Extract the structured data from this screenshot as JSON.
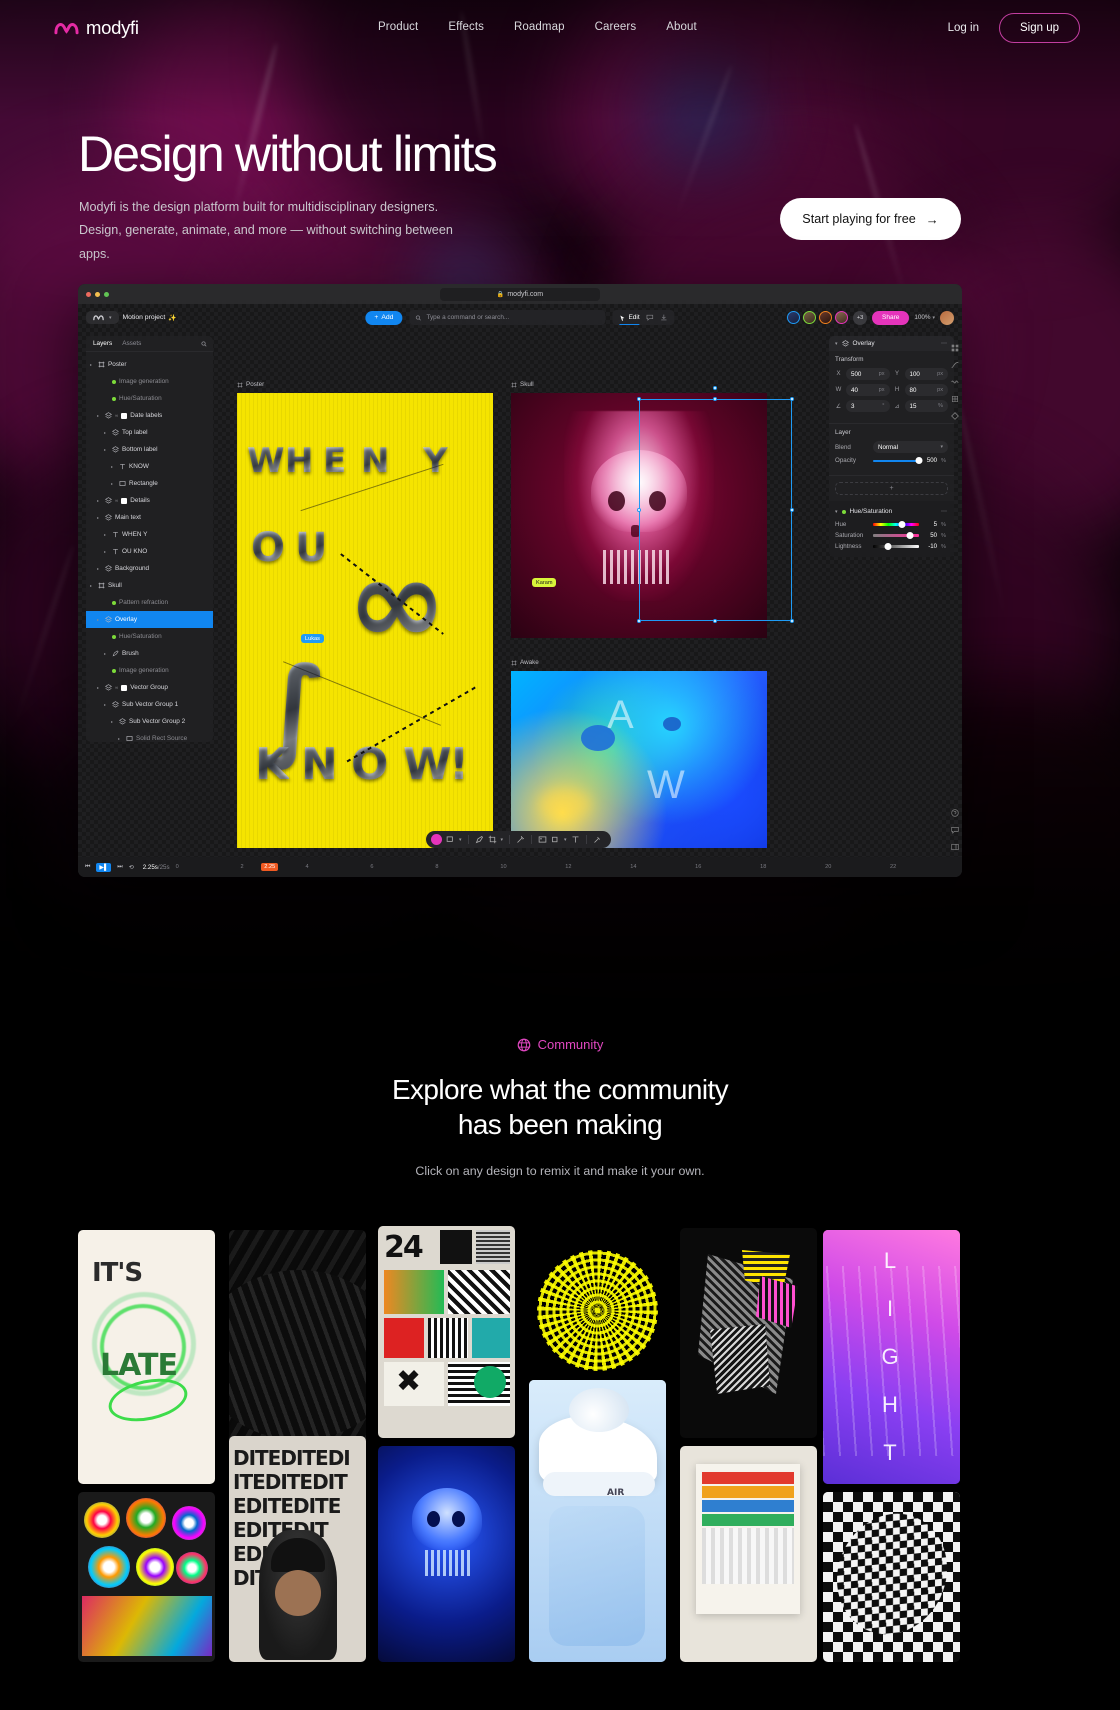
{
  "nav": {
    "logo_text": "modyfi",
    "logo_icon": "modyfi-logo-icon",
    "links": [
      {
        "label": "Product"
      },
      {
        "label": "Effects"
      },
      {
        "label": "Roadmap"
      },
      {
        "label": "Careers"
      },
      {
        "label": "About"
      }
    ],
    "login_label": "Log in",
    "signup_label": "Sign up",
    "accent": "#c23ea0"
  },
  "hero": {
    "title": "Design without limits",
    "subtitle": "Modyfi is the design platform built for multidisciplinary designers. Design, generate, animate, and more — without switching between apps.",
    "cta_label": "Start playing for free",
    "cta_arrow": "→"
  },
  "app": {
    "browser": {
      "url": "modyfi.com",
      "lock_icon": "lock-icon",
      "dots": [
        "close-dot",
        "minimize-dot",
        "maximize-dot"
      ]
    },
    "toolbar": {
      "project_name": "Motion project",
      "project_sparkle": "✨",
      "add_label": "Add",
      "search_placeholder": "Type a command or search...",
      "edit_label": "Edit",
      "comment_icon": "comment-icon",
      "export_icon": "download-icon",
      "collaborators_extra": "+3",
      "share_label": "Share",
      "zoom_level": "100%"
    },
    "layers_panel": {
      "tab_layers": "Layers",
      "tab_assets": "Assets",
      "search_icon": "search-icon",
      "items": [
        {
          "label": "Poster",
          "depth": 0,
          "type": "group",
          "dim": false,
          "selected": false
        },
        {
          "label": "Image generation",
          "depth": 2,
          "type": "effect",
          "dim": true,
          "selected": false
        },
        {
          "label": "Hue/Saturation",
          "depth": 2,
          "type": "effect",
          "dim": true,
          "selected": false
        },
        {
          "label": "Date labels",
          "depth": 1,
          "type": "maskgroup",
          "dim": false,
          "selected": false
        },
        {
          "label": "Top label",
          "depth": 2,
          "type": "layer",
          "dim": false,
          "selected": false
        },
        {
          "label": "Bottom label",
          "depth": 2,
          "type": "layer",
          "dim": false,
          "selected": false
        },
        {
          "label": "KNOW",
          "depth": 3,
          "type": "text",
          "dim": false,
          "selected": false
        },
        {
          "label": "Rectangle",
          "depth": 3,
          "type": "shape",
          "dim": false,
          "selected": false
        },
        {
          "label": "Details",
          "depth": 1,
          "type": "maskgroup",
          "dim": false,
          "selected": false
        },
        {
          "label": "Main text",
          "depth": 1,
          "type": "layer",
          "dim": false,
          "selected": false
        },
        {
          "label": "WHEN Y",
          "depth": 2,
          "type": "text",
          "dim": false,
          "selected": false
        },
        {
          "label": "OU KNO",
          "depth": 2,
          "type": "text",
          "dim": false,
          "selected": false
        },
        {
          "label": "Background",
          "depth": 1,
          "type": "layer",
          "dim": false,
          "selected": false
        },
        {
          "label": "Skull",
          "depth": 0,
          "type": "group",
          "dim": false,
          "selected": false
        },
        {
          "label": "Pattern refraction",
          "depth": 2,
          "type": "effect",
          "dim": true,
          "selected": false
        },
        {
          "label": "Overlay",
          "depth": 1,
          "type": "layer",
          "dim": false,
          "selected": true
        },
        {
          "label": "Hue/Saturation",
          "depth": 2,
          "type": "effect",
          "dim": true,
          "selected": false
        },
        {
          "label": "Brush",
          "depth": 2,
          "type": "brush",
          "dim": false,
          "selected": false
        },
        {
          "label": "Image generation",
          "depth": 2,
          "type": "effect",
          "dim": true,
          "selected": false
        },
        {
          "label": "Vector Group",
          "depth": 1,
          "type": "maskgroup",
          "dim": false,
          "selected": false
        },
        {
          "label": "Sub Vector Group 1",
          "depth": 2,
          "type": "layer",
          "dim": false,
          "selected": false
        },
        {
          "label": "Sub Vector Group 2",
          "depth": 3,
          "type": "layer",
          "dim": false,
          "selected": false
        },
        {
          "label": "Solid Rect Source",
          "depth": 4,
          "type": "shape",
          "dim": true,
          "selected": false
        }
      ]
    },
    "canvas": {
      "frames": [
        {
          "label": "Poster"
        },
        {
          "label": "Skull"
        },
        {
          "label": "Awake"
        }
      ],
      "poster_words": [
        "WHEN",
        "Y",
        "OU",
        "KNO",
        "W"
      ],
      "awake_letters": [
        "A",
        "W"
      ],
      "cursors": [
        {
          "name": "Karam",
          "color": "#d9f53a"
        },
        {
          "name": "Lukas",
          "color": "#1f9bf5"
        }
      ]
    },
    "properties": {
      "header": "Overlay",
      "menu_icon": "more-icon",
      "transform_title": "Transform",
      "fields": [
        {
          "key": "X",
          "value": "500",
          "unit": "px"
        },
        {
          "key": "Y",
          "value": "100",
          "unit": "px"
        },
        {
          "key": "W",
          "value": "40",
          "unit": "px"
        },
        {
          "key": "H",
          "value": "80",
          "unit": "px"
        },
        {
          "key": "∠",
          "value": "3",
          "unit": "°"
        },
        {
          "key": "⊿",
          "value": "15",
          "unit": "%"
        }
      ],
      "layer_title": "Layer",
      "blend_label": "Blend",
      "blend_value": "Normal",
      "opacity_label": "Opacity",
      "opacity_value": "500",
      "opacity_unit": "%",
      "add_effect_label": "+",
      "effect_header": "Hue/Saturation",
      "effect_rows": [
        {
          "label": "Hue",
          "value": "5",
          "unit": "%",
          "pos": 62
        },
        {
          "label": "Saturation",
          "value": "50",
          "unit": "%",
          "pos": 80
        },
        {
          "label": "Lightness",
          "value": "-10",
          "unit": "%",
          "pos": 32
        }
      ]
    },
    "timeline": {
      "current": "2.25s",
      "total": "/25s",
      "playhead_label": "2.25",
      "ticks": [
        "0",
        "2",
        "4",
        "6",
        "8",
        "10",
        "12",
        "14",
        "16",
        "18",
        "20",
        "22"
      ],
      "controls": [
        "skip-back-icon",
        "play-icon",
        "skip-forward-icon",
        "loop-icon"
      ]
    },
    "right_rail_icons": [
      "grid-icon",
      "curve-icon",
      "wave-icon",
      "transform-icon",
      "keyframe-icon"
    ],
    "right_rail_bottom_icons": [
      "help-icon",
      "comment-icon",
      "panel-icon"
    ]
  },
  "community": {
    "tag": "Community",
    "tag_icon": "globe-icon",
    "tag_color": "#e047c0",
    "title_line1": "Explore what the community",
    "title_line2": "has been making",
    "subtitle": "Click on any design to remix it and make it your own.",
    "cards": [
      {
        "name": "card-its-late",
        "caption": "IT'S LATE"
      },
      {
        "name": "card-dark-swirl",
        "caption": ""
      },
      {
        "name": "card-24-grid-poster",
        "caption": "24"
      },
      {
        "name": "card-yellow-sphere",
        "caption": ""
      },
      {
        "name": "card-pixel-glitch",
        "caption": ""
      },
      {
        "name": "card-light",
        "caption": "LIGHT"
      },
      {
        "name": "card-edit-type",
        "caption": "EDITEDITEDIT"
      },
      {
        "name": "card-sneaker",
        "caption": "AIR"
      },
      {
        "name": "card-blue-skull",
        "caption": ""
      },
      {
        "name": "card-eyes",
        "caption": ""
      },
      {
        "name": "card-stripes",
        "caption": ""
      },
      {
        "name": "card-checker",
        "caption": ""
      },
      {
        "name": "card-portrait",
        "caption": ""
      }
    ]
  }
}
